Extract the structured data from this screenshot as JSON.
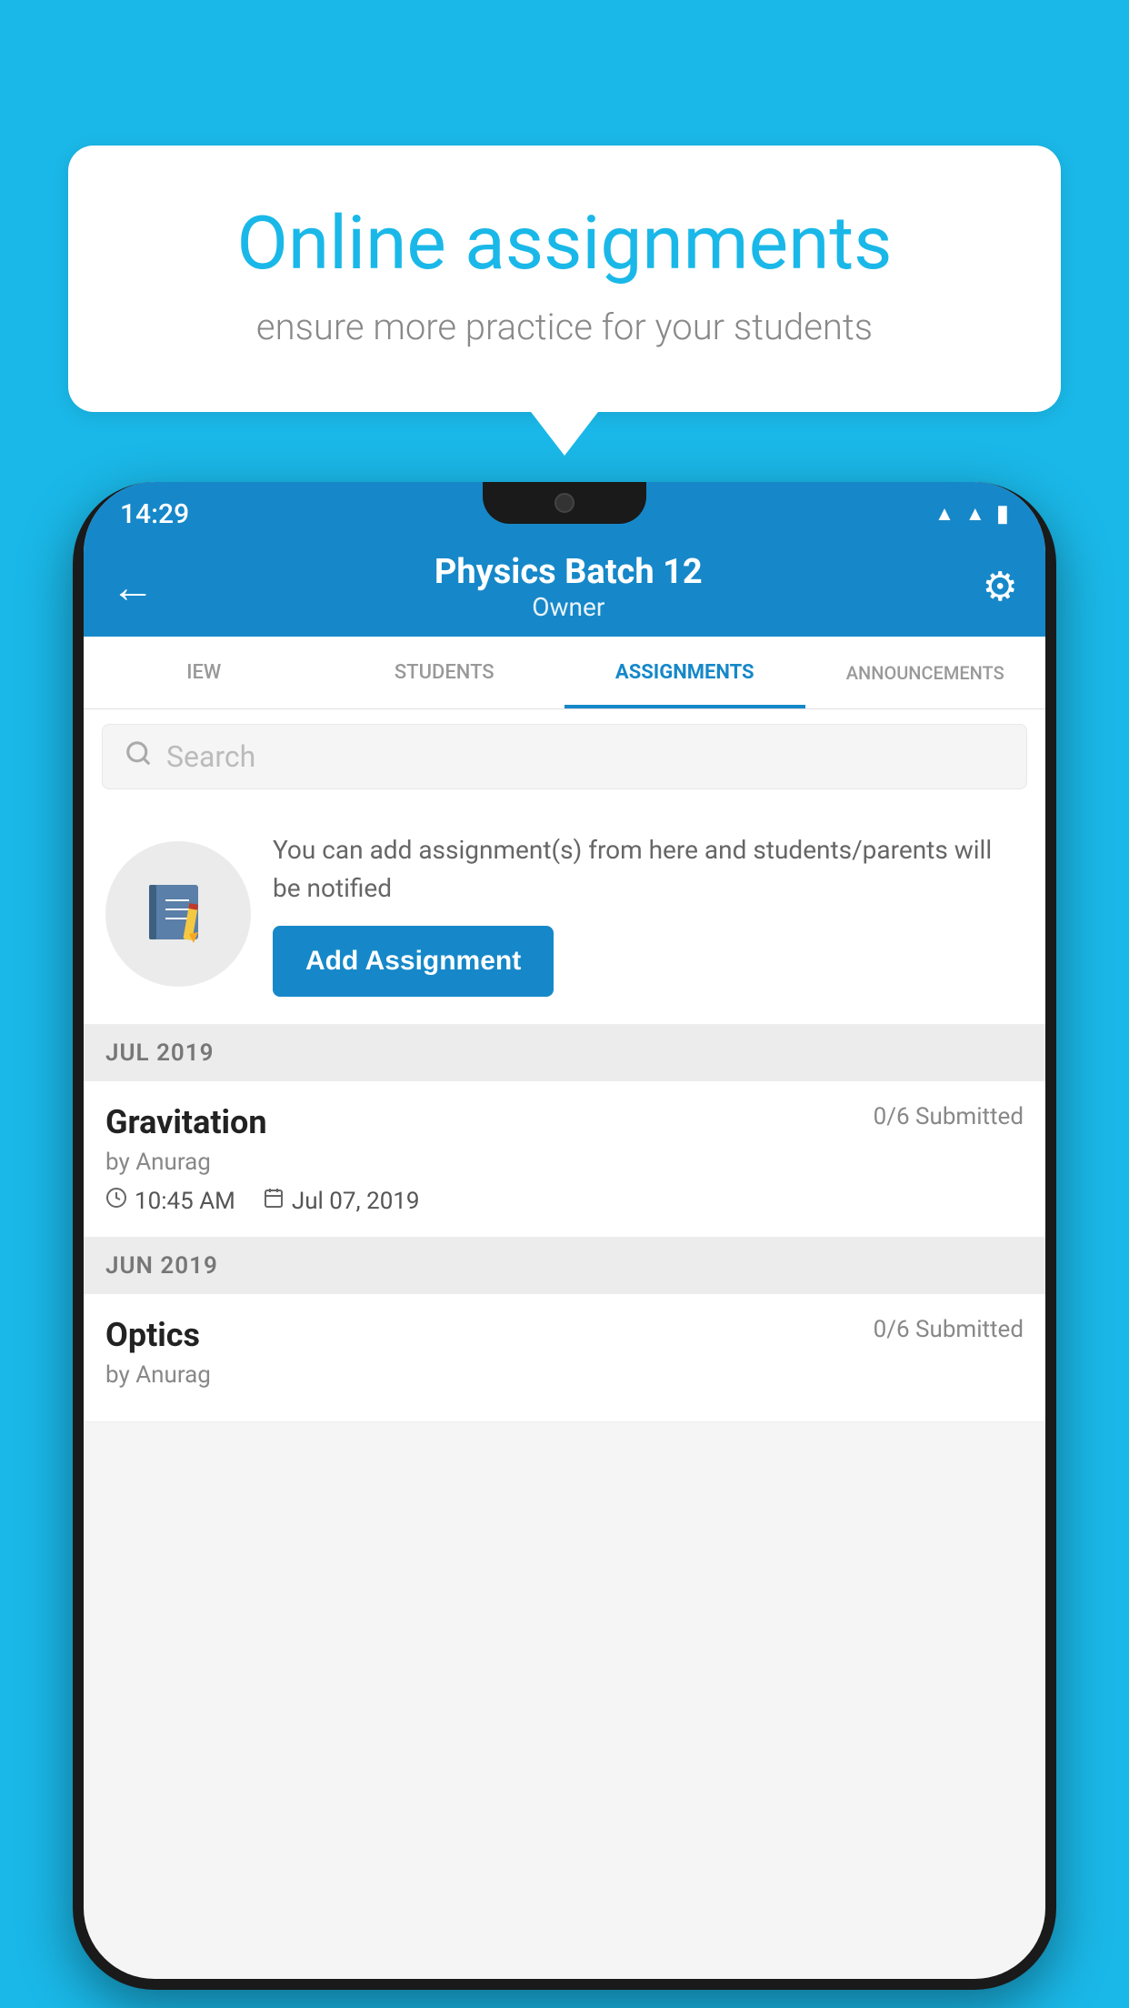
{
  "background_color": "#1ab8e8",
  "bubble": {
    "title": "Online assignments",
    "subtitle": "ensure more practice for your students"
  },
  "status_bar": {
    "time": "14:29",
    "wifi": "▲",
    "signal": "▲",
    "battery": "▮"
  },
  "app_bar": {
    "back_label": "←",
    "title": "Physics Batch 12",
    "subtitle": "Owner",
    "settings_icon": "⚙"
  },
  "tabs": [
    {
      "label": "IEW",
      "active": false
    },
    {
      "label": "STUDENTS",
      "active": false
    },
    {
      "label": "ASSIGNMENTS",
      "active": true
    },
    {
      "label": "ANNOUNCEMENTS",
      "active": false
    }
  ],
  "search": {
    "placeholder": "Search"
  },
  "promo": {
    "text": "You can add assignment(s) from here and students/parents will be notified",
    "button_label": "Add Assignment"
  },
  "sections": [
    {
      "month": "JUL 2019",
      "assignments": [
        {
          "title": "Gravitation",
          "submitted": "0/6 Submitted",
          "by": "by Anurag",
          "time": "10:45 AM",
          "date": "Jul 07, 2019"
        }
      ]
    },
    {
      "month": "JUN 2019",
      "assignments": [
        {
          "title": "Optics",
          "submitted": "0/6 Submitted",
          "by": "by Anurag",
          "time": "",
          "date": ""
        }
      ]
    }
  ]
}
